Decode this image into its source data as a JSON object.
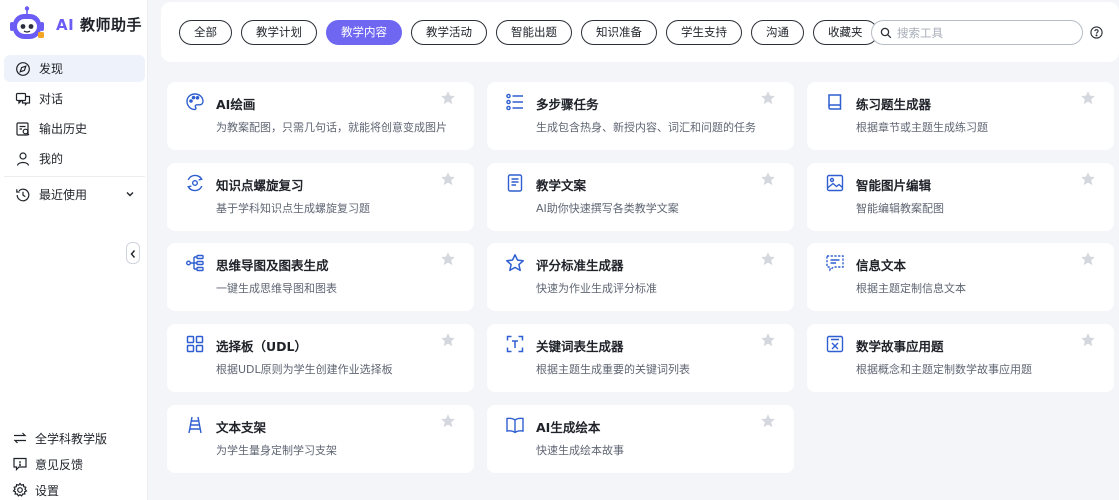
{
  "brand": {
    "prefix": "AI",
    "name": "教师助手"
  },
  "nav": {
    "discover": "发现",
    "chat": "对话",
    "history": "输出历史",
    "mine": "我的",
    "recent": "最近使用"
  },
  "bottom": {
    "edition": "全学科教学版",
    "feedback": "意见反馈",
    "settings": "设置"
  },
  "filters": [
    "全部",
    "教学计划",
    "教学内容",
    "教学活动",
    "智能出题",
    "知识准备",
    "学生支持",
    "沟通",
    "收藏夹"
  ],
  "active_filter": "教学内容",
  "search": {
    "placeholder": "搜索工具",
    "value": ""
  },
  "cards": [
    {
      "icon": "palette-icon",
      "title": "AI绘画",
      "desc": "为教案配图，只需几句话，就能将创意变成图片"
    },
    {
      "icon": "list-steps-icon",
      "title": "多步骤任务",
      "desc": "生成包含热身、新授内容、词汇和问题的任务"
    },
    {
      "icon": "book-icon",
      "title": "练习题生成器",
      "desc": "根据章节或主题生成练习题"
    },
    {
      "icon": "spiral-review-icon",
      "title": "知识点螺旋复习",
      "desc": "基于学科知识点生成螺旋复习题"
    },
    {
      "icon": "document-icon",
      "title": "教学文案",
      "desc": "AI助你快速撰写各类教学文案"
    },
    {
      "icon": "image-edit-icon",
      "title": "智能图片编辑",
      "desc": "智能编辑教案配图"
    },
    {
      "icon": "mindmap-icon",
      "title": "思维导图及图表生成",
      "desc": "一键生成思维导图和图表"
    },
    {
      "icon": "star-outline-icon",
      "title": "评分标准生成器",
      "desc": "快速为作业生成评分标准"
    },
    {
      "icon": "message-text-icon",
      "title": "信息文本",
      "desc": "根据主题定制信息文本"
    },
    {
      "icon": "grid-choice-icon",
      "title": "选择板（UDL）",
      "desc": "根据UDL原则为学生创建作业选择板"
    },
    {
      "icon": "keyword-scan-icon",
      "title": "关键词表生成器",
      "desc": "根据主题生成重要的关键词列表"
    },
    {
      "icon": "math-story-icon",
      "title": "数学故事应用题",
      "desc": "根据概念和主题定制数学故事应用题"
    },
    {
      "icon": "scaffold-icon",
      "title": "文本支架",
      "desc": "为学生量身定制学习支架"
    },
    {
      "icon": "open-book-icon",
      "title": "AI生成绘本",
      "desc": "快速生成绘本故事"
    }
  ],
  "colors": {
    "accent": "#6f67f2",
    "icon_blue": "#2f5fd0",
    "star": "#d4d7dd"
  }
}
